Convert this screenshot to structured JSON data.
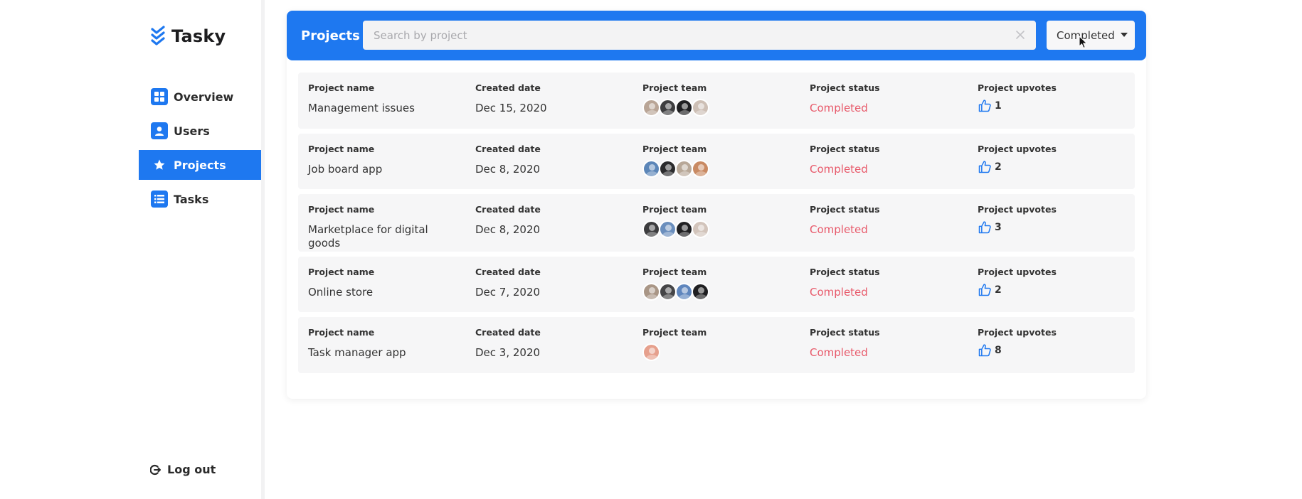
{
  "brand": {
    "name": "Tasky"
  },
  "sidebar": {
    "items": [
      {
        "label": "Overview",
        "icon": "grid-icon",
        "active": false
      },
      {
        "label": "Users",
        "icon": "user-icon",
        "active": false
      },
      {
        "label": "Projects",
        "icon": "star-icon",
        "active": true
      },
      {
        "label": "Tasks",
        "icon": "list-icon",
        "active": false
      }
    ],
    "logout_label": "Log out"
  },
  "header": {
    "title": "Projects",
    "search_placeholder": "Search by project",
    "search_value": "",
    "filter_value": "Completed"
  },
  "columns": {
    "name": "Project name",
    "date": "Created date",
    "team": "Project team",
    "status": "Project status",
    "upvotes": "Project upvotes"
  },
  "projects": [
    {
      "name": "Management issues",
      "date": "Dec 15, 2020",
      "status": "Completed",
      "upvotes": "1",
      "team": [
        "#b9a596",
        "#3e3e40",
        "#1f1f21",
        "#cdbfb5"
      ]
    },
    {
      "name": "Job board app",
      "date": "Dec 8, 2020",
      "status": "Completed",
      "upvotes": "2",
      "team": [
        "#5c86b8",
        "#2b2b2d",
        "#b8a898",
        "#c98a63"
      ]
    },
    {
      "name": "Marketplace for digital goods",
      "date": "Dec 8, 2020",
      "status": "Completed",
      "upvotes": "3",
      "team": [
        "#3c3c3e",
        "#6a8ebd",
        "#202022",
        "#d2c4bb"
      ]
    },
    {
      "name": "Online store",
      "date": "Dec 7, 2020",
      "status": "Completed",
      "upvotes": "2",
      "team": [
        "#a99686",
        "#454547",
        "#5f86bd",
        "#1f1f21"
      ]
    },
    {
      "name": "Task manager app",
      "date": "Dec 3, 2020",
      "status": "Completed",
      "upvotes": "8",
      "team": [
        "#e6a08d"
      ]
    }
  ],
  "colors": {
    "accent": "#1e78f0",
    "status_completed": "#e85a6b",
    "row_bg": "#f6f6f7"
  }
}
